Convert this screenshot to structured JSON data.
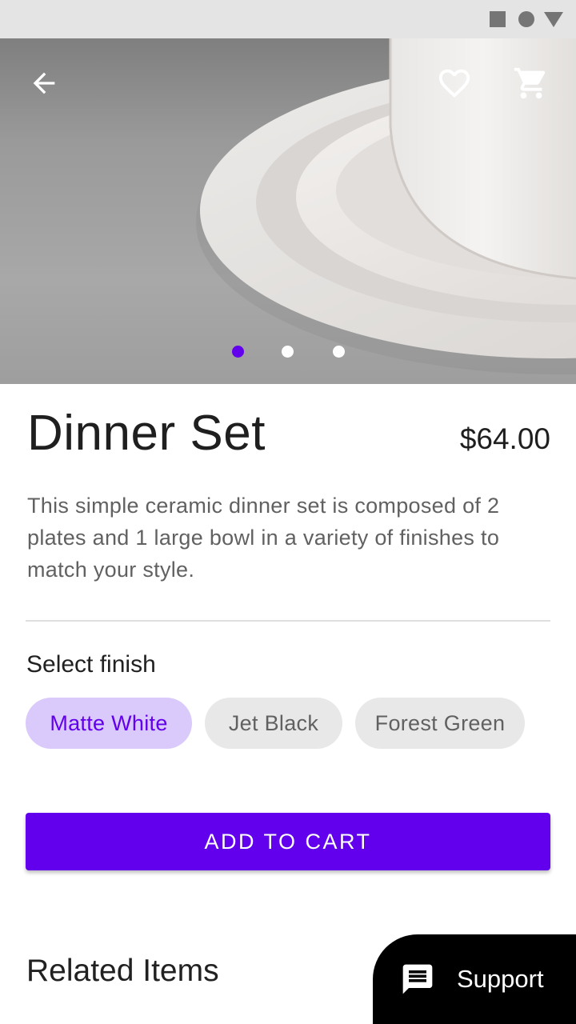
{
  "status_bar": {
    "icons": [
      "square-icon",
      "circle-icon",
      "triangle-icon"
    ]
  },
  "hero": {
    "carousel_total": 3,
    "carousel_active": 1,
    "icons": [
      "back-arrow-icon",
      "heart-icon",
      "shopping-cart-icon"
    ]
  },
  "product": {
    "title": "Dinner Set",
    "price": "$64.00",
    "description": "This simple ceramic dinner set is composed of 2 plates and 1 large bowl in a variety of finishes to match your style."
  },
  "finish": {
    "label": "Select finish",
    "options": [
      "Matte White",
      "Jet Black",
      "Forest Green"
    ],
    "selected": "Matte White"
  },
  "actions": {
    "add_to_cart": "ADD TO CART"
  },
  "related": {
    "heading": "Related Items"
  },
  "support": {
    "label": "Support",
    "icon": "chat-icon"
  },
  "colors": {
    "primary": "#6200ee",
    "chip_selected_bg": "#dac9fb",
    "chip_bg": "#e8e8e8",
    "support_bg": "#000000"
  }
}
